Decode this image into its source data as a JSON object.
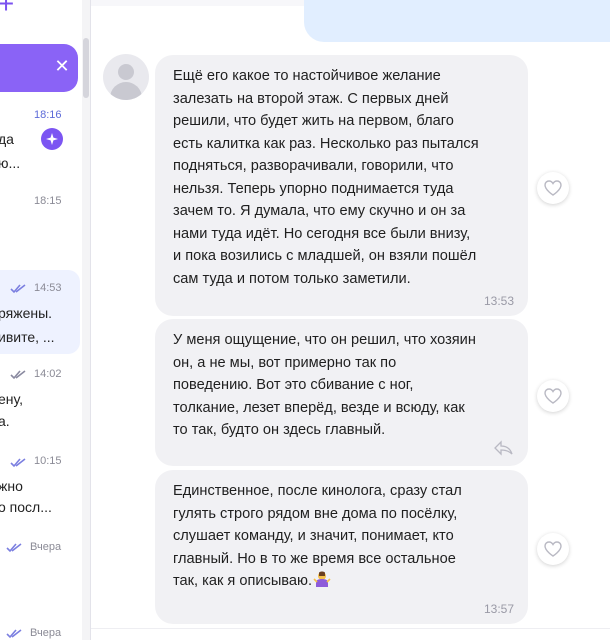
{
  "sidebar": {
    "chats": [
      {
        "time": "18:16",
        "lines": [
          "да",
          "ю..."
        ],
        "unread": true,
        "read_check": false
      },
      {
        "time": "18:15",
        "lines": [],
        "unread": false,
        "read_check": false
      },
      {
        "time": "14:53",
        "lines": [
          "ряжены.",
          "ивите, ..."
        ],
        "active": true,
        "read_check": true
      },
      {
        "time": "14:02",
        "lines": [
          "ену,",
          "а."
        ],
        "read_check": true
      },
      {
        "time": "10:15",
        "lines": [
          "жно",
          "о посл..."
        ],
        "read_check": true
      },
      {
        "time": "Вчера",
        "lines": [],
        "read_check": true
      },
      {
        "time": "Вчера",
        "lines": [],
        "read_check": true
      }
    ]
  },
  "messages": [
    {
      "text": "Ещё его какое то настойчивое желание\nзалезать на второй этаж. С первых дней\nрешили, что будет жить на первом, благо\nесть калитка как раз. Несколько раз пытался\nподняться, разворачивали, говорили, что\nнельзя. Теперь упорно поднимается туда\nзачем то. Я думала, что ему скучно и он за\nнами туда идёт. Но сегодня все были внизу,\nи пока возились с младшей, он взяли пошёл\nсам туда и потом только заметили.",
      "time": "13:53"
    },
    {
      "text": "У меня ощущение, что он решил, что хозяин\nон, а не мы, вот примерно так по\nповедению. Вот это сбивание с ног,\nтолкание, лезет вперёд, везде и всюду, как\nто так, будто он здесь главный.",
      "time": ""
    },
    {
      "text": "Единственное, после кинолога, сразу стал\nгулять строго рядом вне дома по посёлку,\nслушает команду, и  значит, понимает, кто\nглавный. Но в то же время все остальное\nтак, как я описываю.",
      "time": "13:57",
      "emoji": "person-shrugging-emoji"
    }
  ],
  "colors": {
    "accent": "#7b52f0",
    "bubble_incoming": "#f1f1f4",
    "bubble_outgoing": "#e1eeff",
    "active_chat": "#eef2ff"
  }
}
